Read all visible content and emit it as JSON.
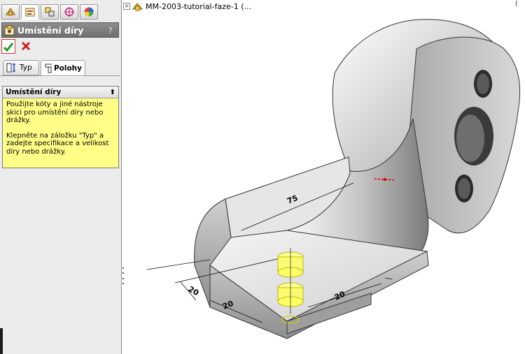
{
  "property_manager": {
    "title": "Umístění díry",
    "help_glyph": "?",
    "ok_tooltip": "OK",
    "cancel_tooltip": "Cancel",
    "tabs": [
      {
        "name": "feature-manager-tab",
        "icon": "feature-tree-icon"
      },
      {
        "name": "property-manager-tab",
        "icon": "property-manager-icon"
      },
      {
        "name": "configuration-manager-tab",
        "icon": "configuration-icon"
      },
      {
        "name": "dimxpert-tab",
        "icon": "dimxpert-icon"
      },
      {
        "name": "display-manager-tab",
        "icon": "display-manager-icon"
      }
    ],
    "subtabs": {
      "typ": "Typ",
      "polohy": "Polohy"
    },
    "group": {
      "title": "Umístění díry",
      "paragraph1": "Použijte kóty a jiné nástroje skici pro umístění díry nebo drážky.",
      "paragraph2": "Klepněte na záložku \"Typ\" a zadejte specifikace a velikost díry nebo drážky."
    }
  },
  "graphics": {
    "tree_item": "MM-2003-tutorial-faze-1 (...",
    "corner_glyph": "(",
    "dimensions": [
      "75",
      "20",
      "20",
      "20"
    ],
    "colors": {
      "preview_yellow": "#ffff66",
      "sketch_red": "#dd0000",
      "model_gray": "#b8b8b8"
    }
  }
}
